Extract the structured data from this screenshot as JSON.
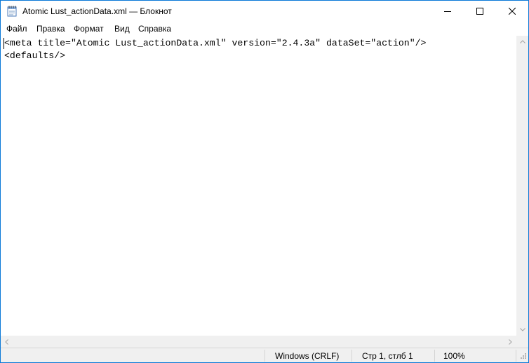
{
  "window": {
    "title": "Atomic Lust_actionData.xml — Блокнот",
    "app_icon": "notepad-icon",
    "controls": [
      "minimize-icon",
      "maximize-icon",
      "close-icon"
    ]
  },
  "menu": {
    "file": "Файл",
    "edit": "Правка",
    "format": "Формат",
    "view": "Вид",
    "help": "Справка"
  },
  "editor": {
    "lines": [
      "<meta title=\"Atomic Lust_actionData.xml\" version=\"2.4.3a\" dataSet=\"action\"/>",
      "<defaults/>"
    ]
  },
  "status": {
    "encoding": "Windows (CRLF)",
    "position": "Стр 1, стлб 1",
    "zoom": "100%"
  }
}
